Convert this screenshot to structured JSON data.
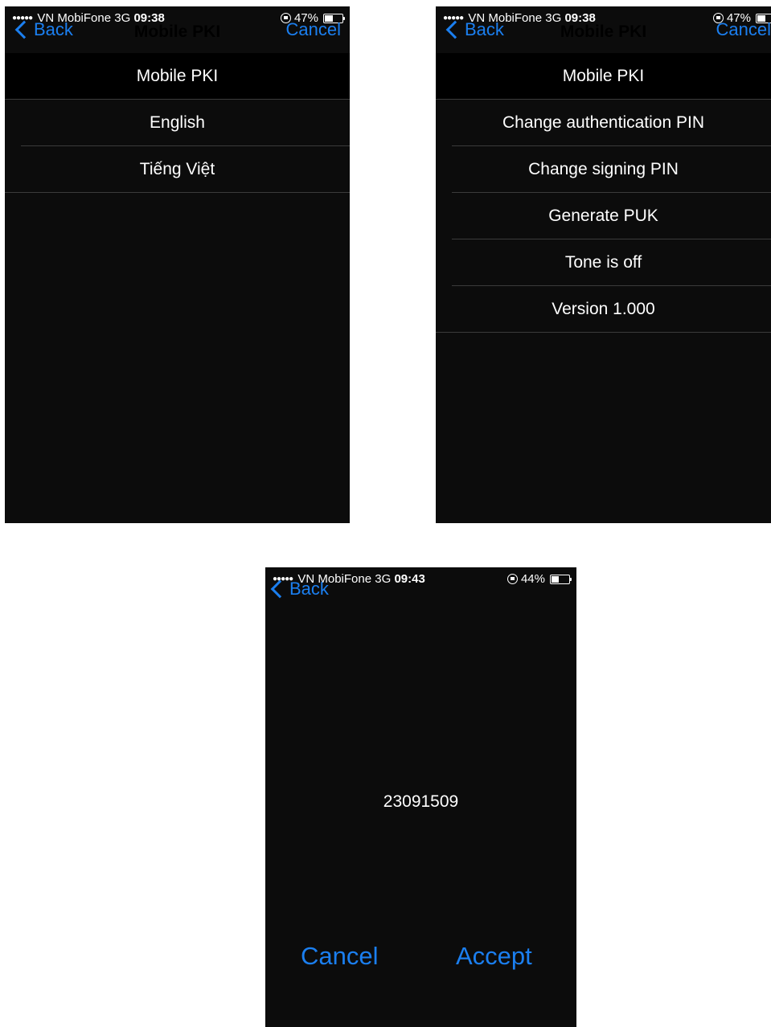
{
  "screens": [
    {
      "status": {
        "carrier": "VN MobiFone",
        "network": "3G",
        "time": "09:38",
        "battery": "47%",
        "battery_level": 0.47
      },
      "nav": {
        "back_label": "Back",
        "title": "Mobile PKI",
        "cancel_label": "Cancel"
      },
      "list": [
        {
          "label": "Mobile PKI"
        },
        {
          "label": "English"
        },
        {
          "label": "Tiếng Việt"
        }
      ]
    },
    {
      "status": {
        "carrier": "VN MobiFone",
        "network": "3G",
        "time": "09:38",
        "battery": "47%",
        "battery_level": 0.47
      },
      "nav": {
        "back_label": "Back",
        "title": "Mobile PKI",
        "cancel_label": "Cancel"
      },
      "list": [
        {
          "label": "Mobile PKI"
        },
        {
          "label": "Change authentication PIN"
        },
        {
          "label": "Change signing PIN"
        },
        {
          "label": "Generate PUK"
        },
        {
          "label": "Tone is off"
        },
        {
          "label": "Version 1.000"
        }
      ]
    },
    {
      "status": {
        "carrier": "VN MobiFone",
        "network": "3G",
        "time": "09:43",
        "battery": "44%",
        "battery_level": 0.44
      },
      "nav": {
        "back_label": "Back"
      },
      "code": "23091509",
      "actions": {
        "cancel_label": "Cancel",
        "accept_label": "Accept"
      }
    }
  ],
  "colors": {
    "accent": "#1b7ff0",
    "background": "#0c0c0c",
    "header_row": "#000000",
    "text": "#ffffff"
  }
}
